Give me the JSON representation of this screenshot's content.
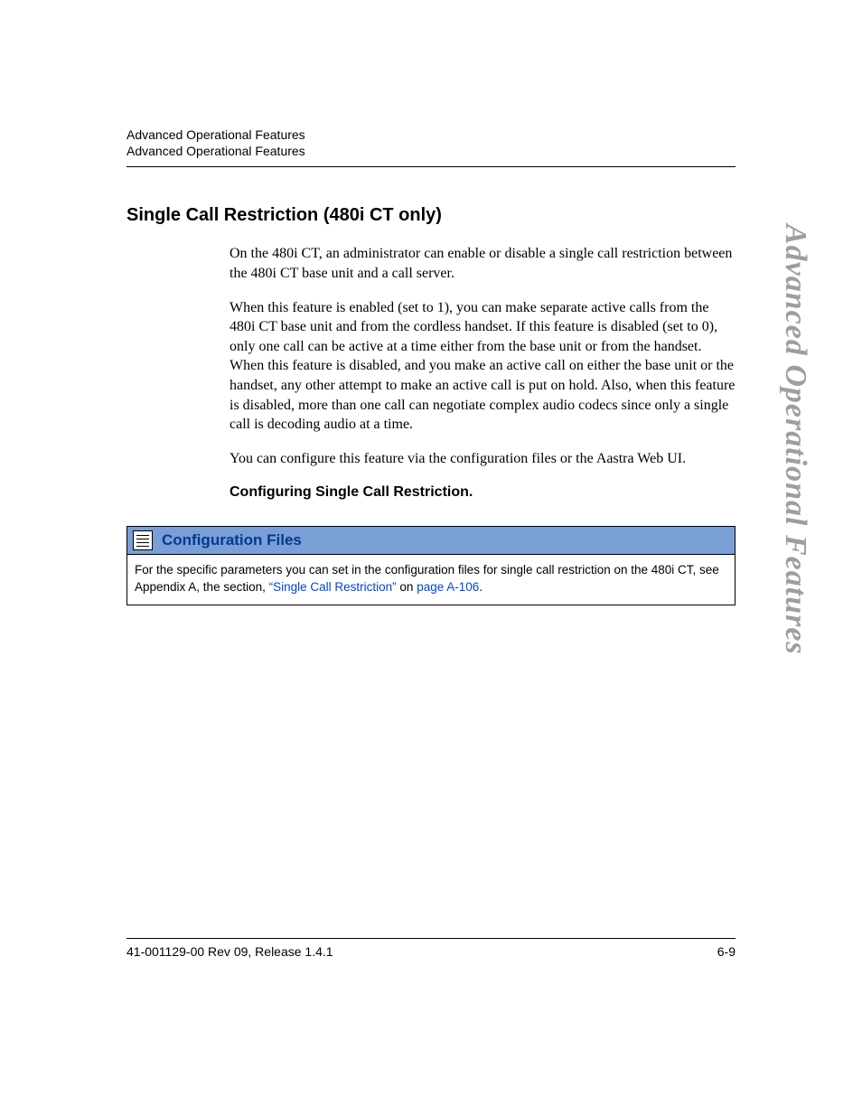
{
  "header": {
    "line1": "Advanced Operational Features",
    "line2": "Advanced Operational Features"
  },
  "section": {
    "title": "Single Call Restriction (480i CT only)",
    "paragraphs": [
      "On the 480i CT, an administrator can enable or disable a single call restriction between the 480i CT base unit and a call server.",
      "When this feature is enabled (set to 1), you can make separate active calls from the 480i CT base unit and from the cordless handset. If this feature is disabled (set to 0), only one call can be active at a time either from the base unit or from the handset. When this feature is disabled, and you make an active call on either the base unit or the handset, any other attempt to make an active call is put on hold. Also, when this feature is disabled, more than one call can negotiate complex audio codecs since only a single call is decoding audio at a time.",
      "You can configure this feature via the configuration files or the Aastra Web UI."
    ],
    "subheading": "Configuring Single Call Restriction."
  },
  "config_box": {
    "title": "Configuration Files",
    "body_pre": "For the specific parameters you can set in the configuration files for single call restriction on the 480i CT, see Appendix A, the section, ",
    "link1": "“Single Call Restriction”",
    "mid": " on ",
    "link2": "page A-106",
    "post": "."
  },
  "side_tab": "Advanced Operational Features",
  "footer": {
    "left": "41-001129-00 Rev 09, Release 1.4.1",
    "right": "6-9"
  }
}
